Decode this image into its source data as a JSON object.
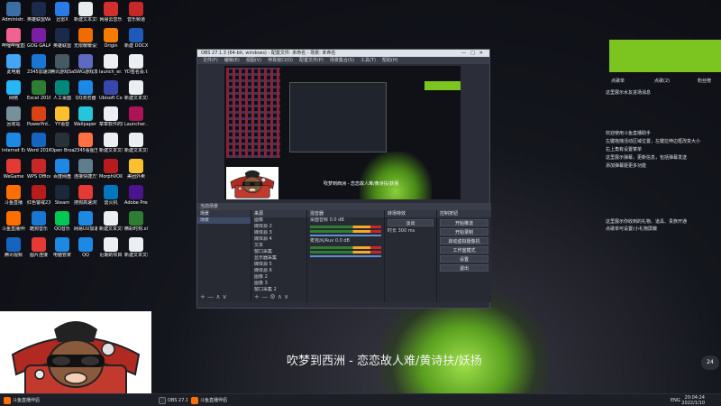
{
  "desktop_icons": [
    {
      "label": "Administr...",
      "color": "#3a6ea5"
    },
    {
      "label": "英雄联盟WeGame版",
      "color": "#1b2a4a"
    },
    {
      "label": "迅雷X",
      "color": "#2a7be4"
    },
    {
      "label": "新建文本文档.txt",
      "color": "#e9ecef"
    },
    {
      "label": "网易云音乐",
      "color": "#d32f2f"
    },
    {
      "label": "音乐频道",
      "color": "#c62828"
    },
    {
      "label": "哔哩哔哩直播姬工具",
      "color": "#f06292"
    },
    {
      "label": "GOG GALAXY",
      "color": "#7b1fa2"
    },
    {
      "label": "英雄联盟",
      "color": "#1b2a4a"
    },
    {
      "label": "无限暖暖设置",
      "color": "#ef6c00"
    },
    {
      "label": "Origin",
      "color": "#f57c00"
    },
    {
      "label": "新建 DOCX 文档.docx",
      "color": "#1e5bb8"
    },
    {
      "label": "此电脑",
      "color": "#42a5f5"
    },
    {
      "label": "2345加速浏览器",
      "color": "#1976d2"
    },
    {
      "label": "腾讯游戏SamPro助手",
      "color": "#455a64"
    },
    {
      "label": "SWG游戏发布器",
      "color": "#5c6bc0"
    },
    {
      "label": "launch_er...",
      "color": "#eceff1"
    },
    {
      "label": "YD签名会.txt",
      "color": "#eceff1"
    },
    {
      "label": "网络",
      "color": "#29b6f6"
    },
    {
      "label": "Excel 2016",
      "color": "#2e7d32"
    },
    {
      "label": "人工桌面",
      "color": "#00897b"
    },
    {
      "label": "QQ浏览器",
      "color": "#1e88e5"
    },
    {
      "label": "Ubisoft Connect",
      "color": "#3949ab"
    },
    {
      "label": "新建文本文档(4).txt",
      "color": "#eceff1"
    },
    {
      "label": "回收站",
      "color": "#78909c"
    },
    {
      "label": "PowerPnt...",
      "color": "#d84315"
    },
    {
      "label": "YY语音",
      "color": "#fbc02d"
    },
    {
      "label": "Wallpaper Engine",
      "color": "#26c6da"
    },
    {
      "label": "章章软件的所有程序.txt",
      "color": "#eceff1"
    },
    {
      "label": "Launcher...",
      "color": "#ad1457"
    },
    {
      "label": "Internet Explorer",
      "color": "#1e88e5"
    },
    {
      "label": "Word 2016",
      "color": "#1565c0"
    },
    {
      "label": "Open Broadcast...",
      "color": "#263238"
    },
    {
      "label": "2345看图王",
      "color": "#ff7043"
    },
    {
      "label": "新建文本文档(3).txt",
      "color": "#eceff1"
    },
    {
      "label": "新建文本文档.txt",
      "color": "#eceff1"
    },
    {
      "label": "WeGame",
      "color": "#e53935"
    },
    {
      "label": "WPS Office",
      "color": "#c62828"
    },
    {
      "label": "百度网盘",
      "color": "#1e88e5"
    },
    {
      "label": "连接快捷方式",
      "color": "#607d8b"
    },
    {
      "label": "MorphVOX Pro",
      "color": "#b71c1c"
    },
    {
      "label": "美团外卖",
      "color": "#fbc02d"
    },
    {
      "label": "斗鱼直播",
      "color": "#ff6f00"
    },
    {
      "label": "红色警戒2尤里的复仇",
      "color": "#b71c1c"
    },
    {
      "label": "Steam",
      "color": "#1b2838"
    },
    {
      "label": "搜狗高速浏览器",
      "color": "#e53935"
    },
    {
      "label": "雷火机",
      "color": "#0277bd"
    },
    {
      "label": "Adobe Premie...",
      "color": "#4a148c"
    },
    {
      "label": "斗鱼直播伴侣",
      "color": "#ff6f00"
    },
    {
      "label": "酷狗音乐",
      "color": "#1976d2"
    },
    {
      "label": "QQ音乐",
      "color": "#00c853"
    },
    {
      "label": "网易UU加速器",
      "color": "#1e88e5"
    },
    {
      "label": "新建文本文档(2).txt",
      "color": "#eceff1"
    },
    {
      "label": "精彩时刻.xlsx",
      "color": "#2e7d32"
    },
    {
      "label": "腾讯视频",
      "color": "#1565c0"
    },
    {
      "label": "图片连接",
      "color": "#e53935"
    },
    {
      "label": "电脑管家",
      "color": "#1e88e5"
    },
    {
      "label": "QQ",
      "color": "#1e88e5"
    },
    {
      "label": "近期的项目",
      "color": "#eceff1"
    },
    {
      "label": "新建文本文档",
      "color": "#eceff1"
    }
  ],
  "right_panel": {
    "accent": "#7cc41f",
    "tabs": [
      "点歌单",
      "点歌(2)",
      "粉丝榜"
    ],
    "notice": "这里展示水友进场消息",
    "welcome_lines": [
      "欢迎使用斗鱼直播助手",
      "左键拖拽活动区域位置，左键拉伸边框改变大小",
      "右上角有设置菜单",
      "这里展示弹幕，更新信息，包括弹幕发送",
      "添加弹幕姬更多功能"
    ],
    "gift_lines": [
      "这里展示你收到的礼物、道具、贵族开通",
      "点歌单可设置(小礼物屏蔽"
    ]
  },
  "obs": {
    "title": "OBS 27.1.3 (64-bit, windows) - 配置文件: 未命名 - 场景: 未命名",
    "window_controls": [
      "—",
      "□",
      "✕"
    ],
    "menu": [
      "文件(F)",
      "编辑(E)",
      "视图(V)",
      "停靠窗口(D)",
      "配置文件(P)",
      "场景集合(S)",
      "工具(T)",
      "帮助(H)"
    ],
    "preview_subtitle": "吹梦到西洲 - 恋恋故人难/黄诗扶/妖扬",
    "scene_bar": "当前场景",
    "docks": {
      "scenes": {
        "title": "场景",
        "items": [
          "场景"
        ],
        "footer": "+ — ∧ ∨"
      },
      "sources": {
        "title": "来源",
        "items": [
          "图像",
          "媒体源 2",
          "媒体源 3",
          "媒体源 4",
          "文本",
          "窗口采集",
          "显示器采集",
          "媒体源 5",
          "媒体源 6",
          "图像 2",
          "图像 3",
          "窗口采集 2"
        ],
        "footer": "+ — ⚙ ∧ ∨"
      },
      "mixer": {
        "title": "混音器",
        "channels": [
          "桌面音频",
          "麦克风/Aux"
        ],
        "levels": [
          "0.0 dB",
          "0.0 dB"
        ]
      },
      "transitions": {
        "title": "转场特效",
        "type": "淡出",
        "duration_label": "时长",
        "duration": "300 ms"
      },
      "controls": {
        "title": "控制按钮",
        "buttons": [
          "开始推流",
          "开始录制",
          "启动虚拟摄像机",
          "工作室模式",
          "设置",
          "退出"
        ]
      }
    }
  },
  "subtitle": "吹梦到西洲 - 恋恋故人难/黄诗扶/妖扬",
  "badge": "24",
  "taskbar": {
    "items": [
      {
        "label": "斗鱼直播伴侣"
      },
      {
        "label": "OBS 27.1.3 (64-bit, windo..."
      },
      {
        "label": "斗鱼直播伴侣"
      }
    ],
    "time": "20:04:24",
    "date": "2022/1/10",
    "lang": "ENG"
  }
}
